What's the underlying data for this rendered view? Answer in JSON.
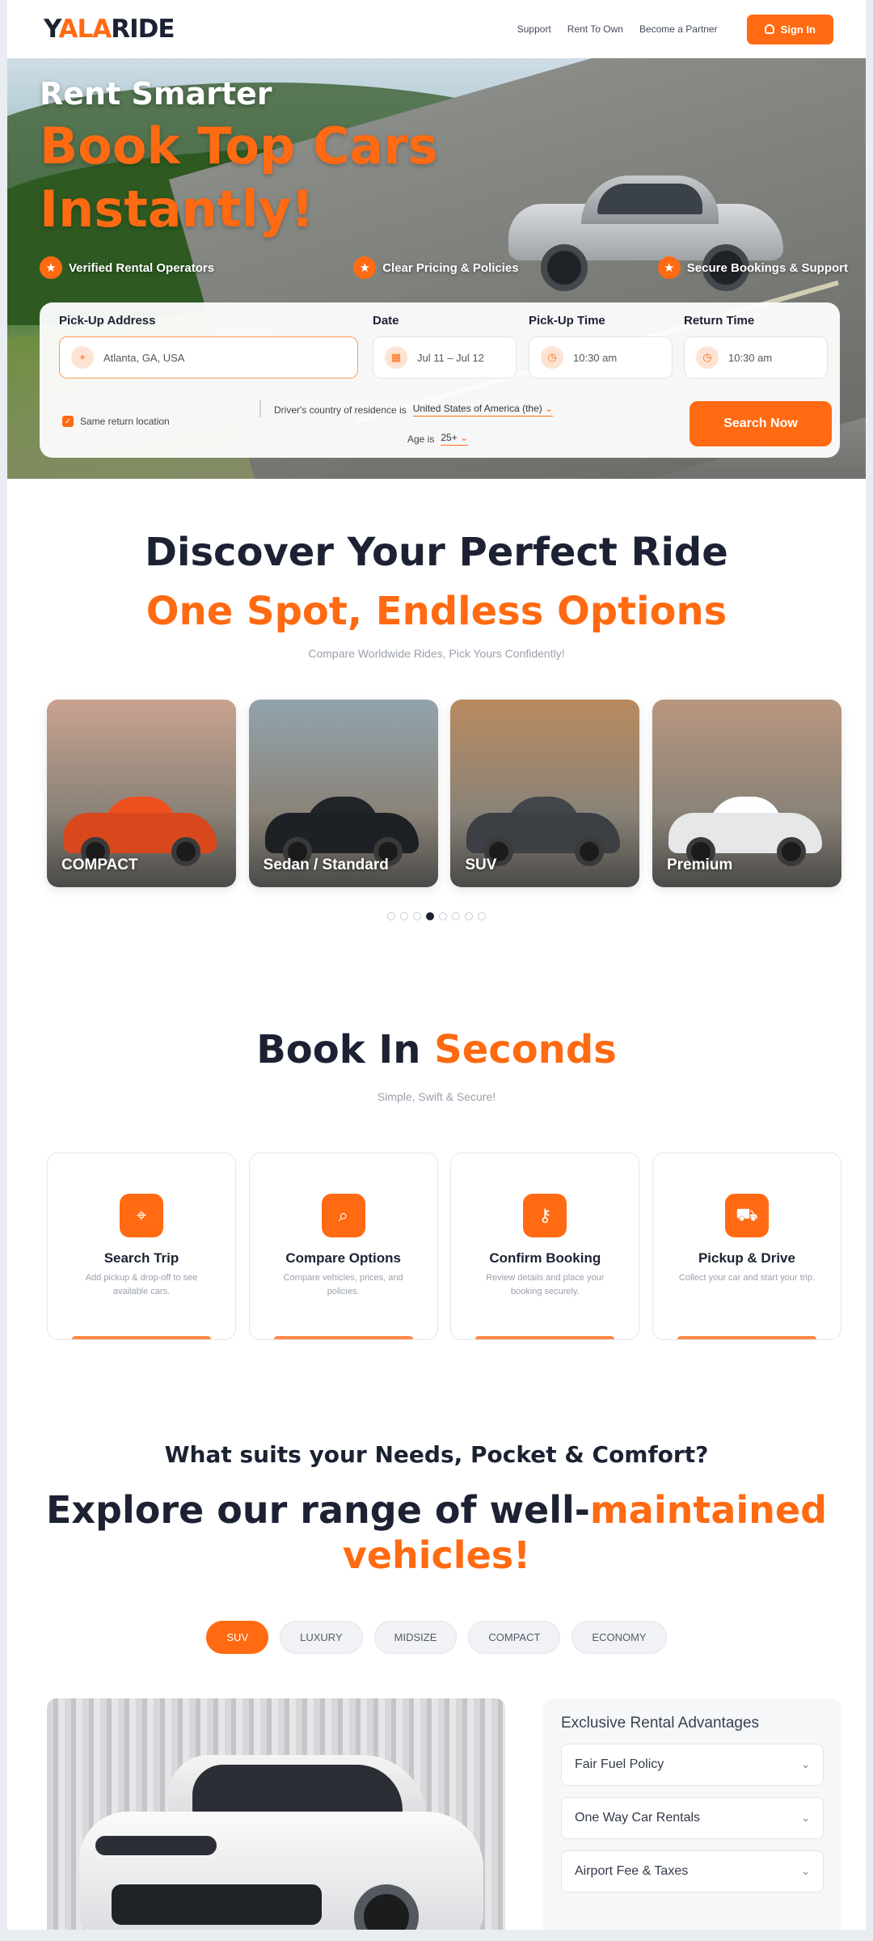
{
  "nav": {
    "logo": {
      "y": "Y",
      "a": "ALA",
      "b": "RIDE"
    },
    "links": [
      "Support",
      "Rent To Own",
      "Become a Partner"
    ],
    "signin": "Sign In"
  },
  "hero": {
    "subtitle": "Rent Smarter",
    "title_line1": "Book Top Cars",
    "title_line2": "Instantly!",
    "badges": [
      "Verified Rental Operators",
      "Clear Pricing & Policies",
      "Secure Bookings & Support"
    ]
  },
  "search": {
    "pickup_label": "Pick-Up Address",
    "pickup_value": "Atlanta, GA, USA",
    "date_label": "Date",
    "date_value": "Jul 11 – Jul 12",
    "pickup_time_label": "Pick-Up Time",
    "pickup_time_value": "10:30 am",
    "return_time_label": "Return Time",
    "return_time_value": "10:30 am",
    "same_return": "Same return location",
    "residence_label": "Driver's country of residence is",
    "residence_value": "United States of America (the)",
    "age_label": "Age is",
    "age_value": "25+",
    "button": "Search Now"
  },
  "discover": {
    "title": "Discover Your Perfect Ride",
    "subtitle": "One Spot, Endless Options",
    "caption": "Compare Worldwide Rides, Pick Yours Confidently!",
    "categories": [
      {
        "label": "COMPACT",
        "bg": "#c9a28f",
        "car": "#d8481c"
      },
      {
        "label": "Sedan / Standard",
        "bg": "#93a4ae",
        "car": "#1d2024"
      },
      {
        "label": "SUV",
        "bg": "#b98a5e",
        "car": "#3c3f43"
      },
      {
        "label": "Premium",
        "bg": "#b9967f",
        "car": "#e6e7e9"
      }
    ],
    "dots_total": 8,
    "dots_active": 4
  },
  "book": {
    "title_a": "Book In ",
    "title_b": "Seconds",
    "caption": "Simple, Swift & Secure!",
    "steps": [
      {
        "icon": "location-pin-icon",
        "glyph": "⌖",
        "title": "Search Trip",
        "desc": "Add pickup & drop-off to see available cars."
      },
      {
        "icon": "search-icon",
        "glyph": "⌕",
        "title": "Compare Options",
        "desc": "Compare vehicles, prices, and policies."
      },
      {
        "icon": "key-icon",
        "glyph": "⚷",
        "title": "Confirm Booking",
        "desc": "Review details and place your booking securely."
      },
      {
        "icon": "car-icon",
        "glyph": "⛟",
        "title": "Pickup & Drive",
        "desc": "Collect your car and start your trip."
      }
    ]
  },
  "explore": {
    "needs": "What suits your Needs, Pocket & Comfort?",
    "line1_a": "Explore our range of well-",
    "line1_b": "maintained",
    "line2": "vehicles!",
    "tabs": [
      "SUV",
      "LUXURY",
      "MIDSIZE",
      "COMPACT",
      "ECONOMY"
    ],
    "active_tab": "SUV",
    "advantages_title": "Exclusive Rental Advantages",
    "advantages": [
      "Fair Fuel Policy",
      "One Way Car Rentals",
      "Airport Fee & Taxes"
    ]
  },
  "colors": {
    "accent": "#ff6a12",
    "dark": "#1c2233"
  }
}
